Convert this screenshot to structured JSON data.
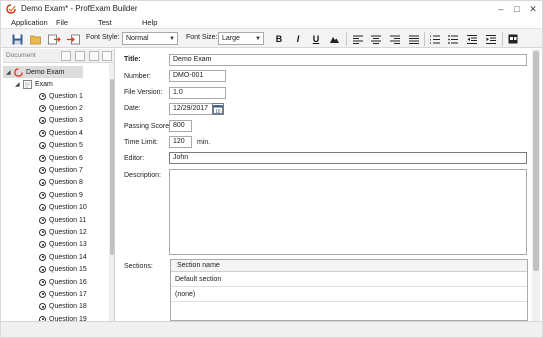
{
  "window": {
    "title": "Demo Exam* - ProfExam Builder"
  },
  "menu": {
    "items": [
      "Application",
      "File",
      "Test",
      "Help"
    ]
  },
  "toolbar": {
    "font_style_label": "Font Style:",
    "font_style_value": "Normal",
    "font_size_label": "Font Size:",
    "font_size_value": "Large",
    "bold": "B",
    "italic": "I",
    "underline": "U"
  },
  "document_panel": {
    "title": "Document",
    "root": "Demo Exam",
    "exam": "Exam",
    "questions": [
      "Question 1",
      "Question 2",
      "Question 3",
      "Question 4",
      "Question 5",
      "Question 6",
      "Question 7",
      "Question 8",
      "Question 9",
      "Question 10",
      "Question 11",
      "Question 12",
      "Question 13",
      "Question 14",
      "Question 15",
      "Question 16",
      "Question 17",
      "Question 18",
      "Question 19"
    ]
  },
  "form": {
    "title_label": "Title:",
    "title_value": "Demo Exam",
    "number_label": "Number:",
    "number_value": "DMO-001",
    "file_version_label": "File Version:",
    "file_version_value": "1.0",
    "date_label": "Date:",
    "date_value": "12/29/2017",
    "date_icon_text": "15",
    "passing_score_label": "Passing Score:",
    "passing_score_value": "800",
    "time_limit_label": "Time Limit:",
    "time_limit_value": "120",
    "time_limit_unit": "min.",
    "editor_label": "Editor:",
    "editor_value": "John",
    "description_label": "Description:",
    "description_value": "",
    "sections_label": "Sections:",
    "sections_header": "Section name",
    "sections": [
      "Default section",
      "(none)"
    ]
  }
}
